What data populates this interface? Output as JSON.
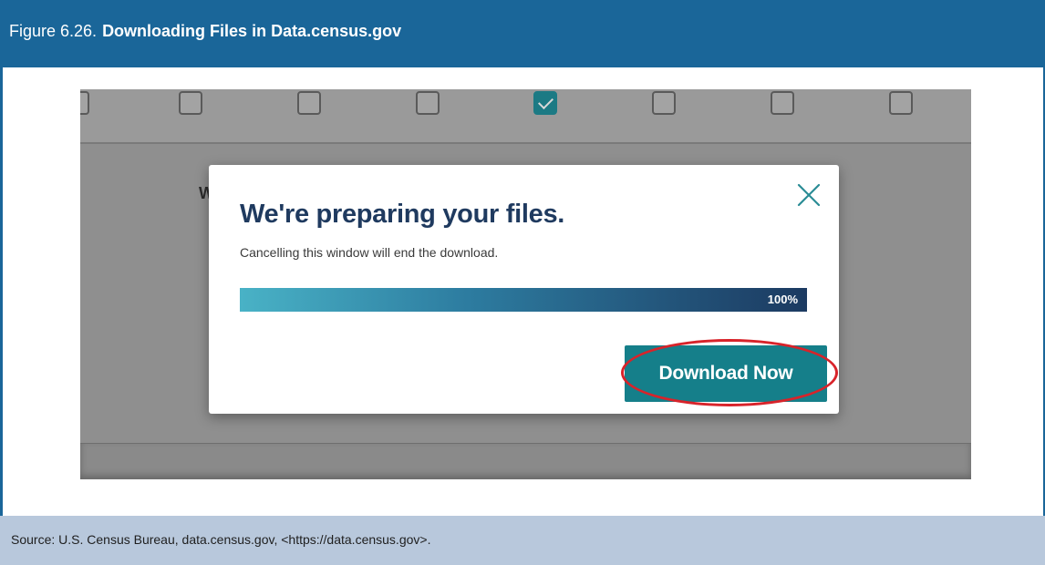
{
  "figure": {
    "number": "Figure 6.26.",
    "title": "Downloading Files in Data.census.gov"
  },
  "screenshot": {
    "background_peek_text": "W",
    "checkboxes": [
      {
        "checked": false
      },
      {
        "checked": false
      },
      {
        "checked": false
      },
      {
        "checked": false
      },
      {
        "checked": true
      },
      {
        "checked": false
      },
      {
        "checked": false
      },
      {
        "checked": false
      }
    ],
    "modal": {
      "heading": "We're preparing your files.",
      "subtext": "Cancelling this window will end the download.",
      "progress_label": "100%",
      "progress_value": 1.0,
      "download_button_label": "Download Now",
      "close_icon": "close-icon"
    }
  },
  "source": {
    "text": "Source: U.S. Census Bureau, data.census.gov, <https://data.census.gov>."
  },
  "colors": {
    "header_bg": "#1a6699",
    "source_bg": "#b8c8dc",
    "button_bg": "#157f8a",
    "heading_color": "#1f3a5f",
    "highlight_ring": "#d8232a"
  }
}
